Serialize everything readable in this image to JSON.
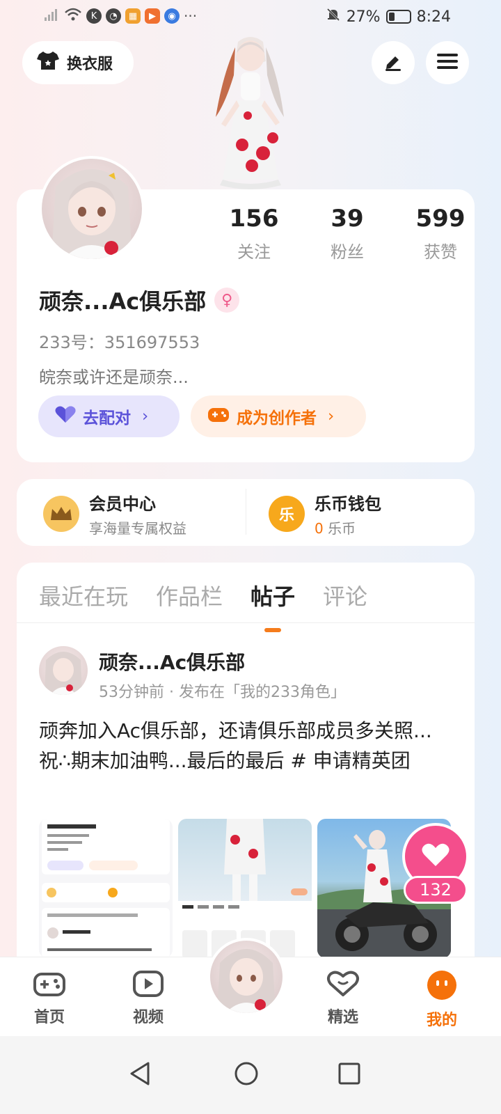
{
  "status_bar": {
    "battery": "27%",
    "time": "8:24",
    "more": "···"
  },
  "header": {
    "dress_label": "换衣服"
  },
  "profile": {
    "following_count": "156",
    "following_label": "关注",
    "followers_count": "39",
    "followers_label": "粉丝",
    "likes_count": "599",
    "likes_label": "获赞",
    "nickname": "顽奈...Ac俱乐部",
    "uid": "233号：351697553",
    "bio": "皖奈或许还是顽奈...",
    "match_label": "去配对",
    "creator_label": "成为创作者"
  },
  "vip": {
    "member_title": "会员中心",
    "member_sub": "享海量专属权益",
    "wallet_title": "乐币钱包",
    "wallet_amount": "0",
    "wallet_unit": "乐币",
    "wallet_icon_char": "乐"
  },
  "tabs": [
    "最近在玩",
    "作品栏",
    "帖子",
    "评论"
  ],
  "active_tab": "帖子",
  "post": {
    "author": "顽奈...Ac俱乐部",
    "meta": "53分钟前 · 发布在「我的233角色」",
    "text": "顽奔加入Ac俱乐部，还请俱乐部成员多关照...祝∴期末加油鸭...最后的最后 # 申请精英团",
    "like_count": "132"
  },
  "bottom_nav": {
    "home": "首页",
    "video": "视频",
    "featured": "精选",
    "mine": "我的"
  },
  "colors": {
    "accent": "#f5710a",
    "like": "#f44e8c",
    "match": "#5b52d9"
  }
}
